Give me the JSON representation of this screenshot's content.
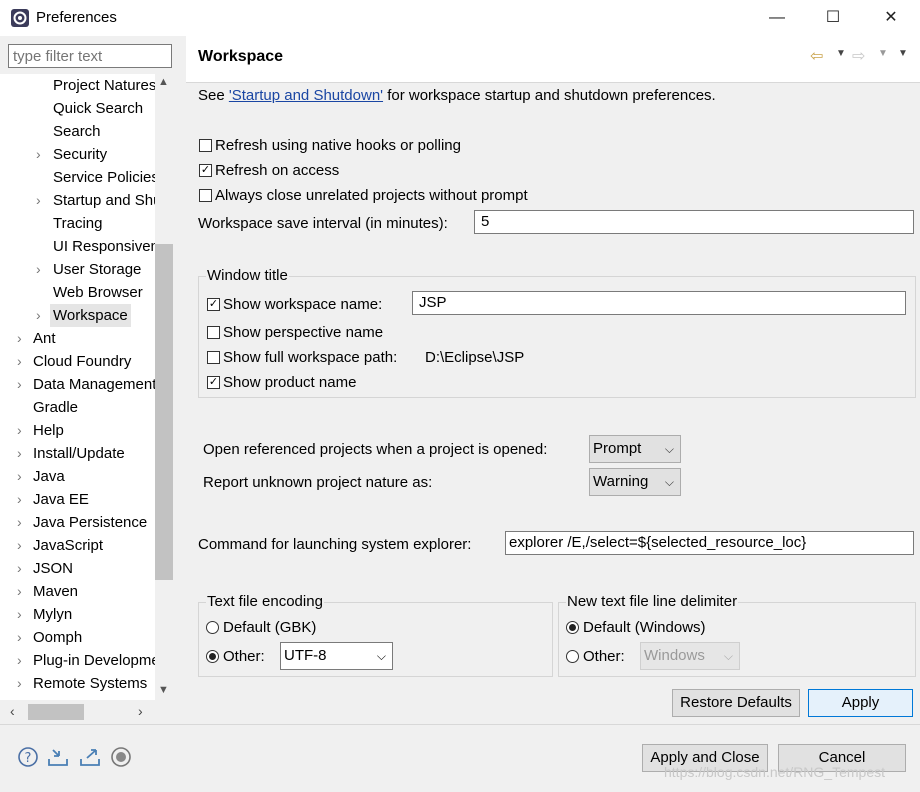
{
  "window": {
    "title": "Preferences",
    "minimize": "—",
    "maximize": "☐",
    "close": "✕"
  },
  "filter": {
    "placeholder": "type filter text"
  },
  "tree": {
    "items": [
      {
        "label": "Project Natures",
        "level": 2,
        "expandable": false
      },
      {
        "label": "Quick Search",
        "level": 2,
        "expandable": false
      },
      {
        "label": "Search",
        "level": 2,
        "expandable": false
      },
      {
        "label": "Security",
        "level": 2,
        "expandable": true
      },
      {
        "label": "Service Policies",
        "level": 2,
        "expandable": false
      },
      {
        "label": "Startup and Shutdown",
        "level": 2,
        "expandable": true
      },
      {
        "label": "Tracing",
        "level": 2,
        "expandable": false
      },
      {
        "label": "UI Responsiveness",
        "level": 2,
        "expandable": false
      },
      {
        "label": "User Storage",
        "level": 2,
        "expandable": true
      },
      {
        "label": "Web Browser",
        "level": 2,
        "expandable": false
      },
      {
        "label": "Workspace",
        "level": 2,
        "expandable": true,
        "selected": true
      },
      {
        "label": "Ant",
        "level": 1,
        "expandable": true
      },
      {
        "label": "Cloud Foundry",
        "level": 1,
        "expandable": true
      },
      {
        "label": "Data Management",
        "level": 1,
        "expandable": true
      },
      {
        "label": "Gradle",
        "level": 1,
        "expandable": false
      },
      {
        "label": "Help",
        "level": 1,
        "expandable": true
      },
      {
        "label": "Install/Update",
        "level": 1,
        "expandable": true
      },
      {
        "label": "Java",
        "level": 1,
        "expandable": true
      },
      {
        "label": "Java EE",
        "level": 1,
        "expandable": true
      },
      {
        "label": "Java Persistence",
        "level": 1,
        "expandable": true
      },
      {
        "label": "JavaScript",
        "level": 1,
        "expandable": true
      },
      {
        "label": "JSON",
        "level": 1,
        "expandable": true
      },
      {
        "label": "Maven",
        "level": 1,
        "expandable": true
      },
      {
        "label": "Mylyn",
        "level": 1,
        "expandable": true
      },
      {
        "label": "Oomph",
        "level": 1,
        "expandable": true
      },
      {
        "label": "Plug-in Development",
        "level": 1,
        "expandable": true
      },
      {
        "label": "Remote Systems",
        "level": 1,
        "expandable": true
      }
    ]
  },
  "page": {
    "title": "Workspace",
    "intro_before": "See ",
    "intro_link": "'Startup and Shutdown'",
    "intro_after": " for workspace startup and shutdown preferences.",
    "refresh_native": {
      "label": "Refresh using native hooks or polling",
      "checked": false
    },
    "refresh_access": {
      "label": "Refresh on access",
      "checked": true
    },
    "always_close": {
      "label": "Always close unrelated projects without prompt",
      "checked": false
    },
    "save_interval": {
      "label": "Workspace save interval (in minutes):",
      "value": "5"
    },
    "window_title": {
      "group_label": "Window title",
      "show_name": {
        "label": "Show workspace name:",
        "checked": true,
        "value": "JSP"
      },
      "show_perspective": {
        "label": "Show perspective name",
        "checked": false
      },
      "show_path": {
        "label": "Show full workspace path:",
        "checked": false,
        "value": "D:\\Eclipse\\JSP"
      },
      "show_product": {
        "label": "Show product name",
        "checked": true
      }
    },
    "open_referenced": {
      "label": "Open referenced projects when a project is opened:",
      "value": "Prompt"
    },
    "report_nature": {
      "label": "Report unknown project nature as:",
      "value": "Warning"
    },
    "explorer": {
      "label": "Command for launching system explorer:",
      "value": "explorer /E,/select=${selected_resource_loc}"
    },
    "encoding": {
      "group_label": "Text file encoding",
      "default_label": "Default (GBK)",
      "other_label": "Other:",
      "other_value": "UTF-8",
      "selected": "other"
    },
    "delimiter": {
      "group_label": "New text file line delimiter",
      "default_label": "Default (Windows)",
      "other_label": "Other:",
      "other_value": "Windows",
      "selected": "default"
    },
    "restore_defaults": "Restore Defaults",
    "apply": "Apply"
  },
  "footer": {
    "apply_close": "Apply and Close",
    "cancel": "Cancel"
  },
  "watermark": "https://blog.csdn.net/RNG_Tempest"
}
